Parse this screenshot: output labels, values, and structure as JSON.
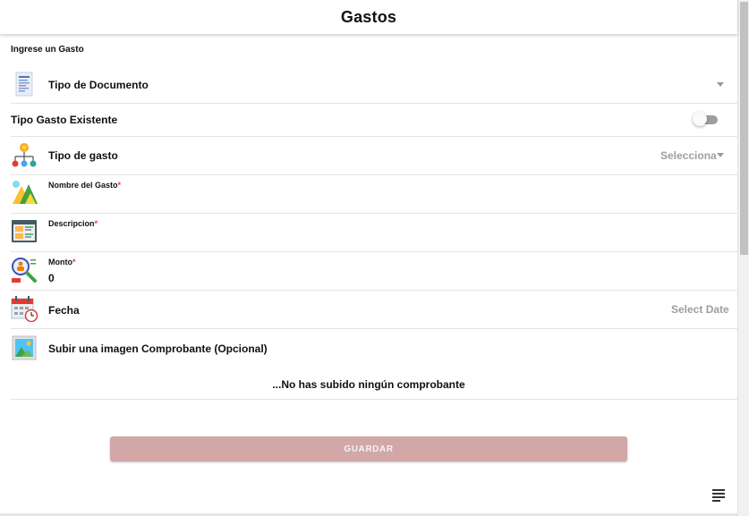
{
  "header": {
    "title": "Gastos"
  },
  "form": {
    "section_title": "Ingrese un Gasto",
    "tipo_documento": {
      "label": "Tipo de Documento"
    },
    "tipo_gasto_existente": {
      "label": "Tipo Gasto Existente",
      "enabled": false
    },
    "tipo_gasto": {
      "label": "Tipo de gasto",
      "placeholder": "Selecciona"
    },
    "nombre_gasto": {
      "label": "Nombre del Gasto",
      "required_mark": "*"
    },
    "descripcion": {
      "label": "Descripcion",
      "required_mark": "*"
    },
    "monto": {
      "label": "Monto",
      "required_mark": "*",
      "value": "0"
    },
    "fecha": {
      "label": "Fecha",
      "placeholder": "Select Date"
    },
    "comprobante": {
      "label": "Subir una imagen Comprobante (Opcional)",
      "empty_message": "...No has subido ningún comprobante"
    },
    "save_button": "GUARDAR"
  },
  "colors": {
    "button_bg": "#d2a7a7",
    "required": "#e53935"
  }
}
